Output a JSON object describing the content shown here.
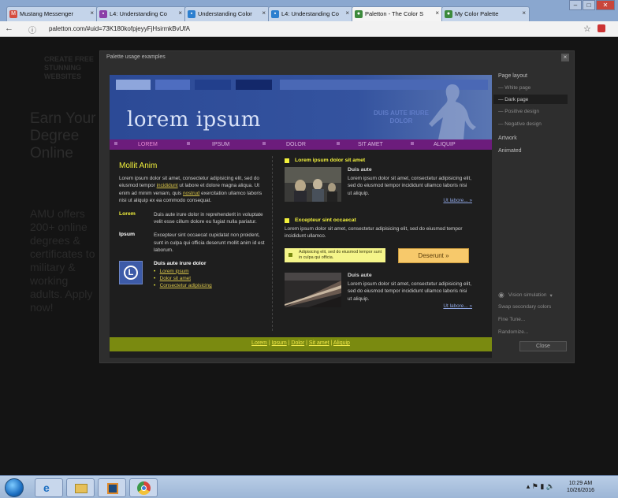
{
  "browser": {
    "tabs": [
      {
        "label": "Mustang Messenger",
        "icon": "gmail-icon",
        "color": "#d54c3f"
      },
      {
        "label": "L4: Understanding Co",
        "icon": "course-icon",
        "color": "#8b3fa8"
      },
      {
        "label": "Understanding Color",
        "icon": "course-icon",
        "color": "#2c7fcf"
      },
      {
        "label": "L4: Understanding Co",
        "icon": "course-icon",
        "color": "#2c7fcf"
      },
      {
        "label": "Paletton - The Color S",
        "icon": "paletton-icon",
        "color": "#3c8a3c"
      },
      {
        "label": "My Color Palette",
        "icon": "paletton-icon",
        "color": "#3c8a3c"
      }
    ],
    "url": "paletton.com/#uid=73K180kofpjeyyFjHsirmkBvUfA"
  },
  "background_ad": {
    "lines": [
      "CREATE FREE",
      "STUNNING",
      "WEBSITES"
    ],
    "headline": "Earn Your Degree Online",
    "body": "AMU offers 200+ online degrees & certificates to military & working adults. Apply now!"
  },
  "modal": {
    "title": "Palette usage examples",
    "close_label": "×"
  },
  "preview": {
    "hero_title": "lorem ipsum",
    "hero_sub": "DUIS AUTE IRURE DOLOR",
    "nav": [
      "LOREM",
      "IPSUM",
      "DOLOR",
      "SIT AMET",
      "ALIQUIP"
    ],
    "left": {
      "heading": "Mollit Anim",
      "para1_a": "Lorem ipsum dolor sit amet, consectetur adipisicing elit, sed do eiusmod tempor ",
      "para1_link1": "incididunt",
      "para1_b": " ut labore et dolore magna aliqua. Ut enim ad minim veniam, quis ",
      "para1_link2": "nostrud",
      "para1_c": " exercitation ullamco laboris nisi ut aliquip ex ea commodo consequat.",
      "def1_term": "Lorem",
      "def1_text": "Duis aute irure dolor in reprehenderit in voluptate velit esse cillum dolore eu fugiat nulla pariatur.",
      "def2_term": "Ipsum",
      "def2_text": "Excepteur sint occaecat cupidatat non proident, sunt in culpa qui officia deserunt mollit anim id est laborum.",
      "list_heading": "Duis aute irure dolor",
      "list": [
        "Lorem ipsum",
        "Dolor sit amet",
        "Consectetur adipisicing"
      ]
    },
    "right": {
      "heading1": "Lorem ipsum dolor sit amet",
      "card1_title": "Duis aute",
      "card1_text": "Lorem ipsum dolor sit amet, consectetur adipisicing elit, sed do eiusmod tempor incididunt ullamco laboris nisi ut aliquip.",
      "card1_link": "Ut labore... »",
      "heading2": "Excepteur sint occaecat",
      "para2": "Lorem ipsum dolor sit amet, consectetur adipisicing elit, sed do eiusmod tempor incididunt ullamco.",
      "note": "Adipisicing elit, sed do eiusmod tempor sunt in culpa qui officia.",
      "button": "Deserunt »",
      "card2_title": "Duis aute",
      "card2_text": "Lorem ipsum dolor sit amet, consectetur adipisicing elit, sed do eiusmod tempor incididunt ullamco laboris nisi ut aliquip.",
      "card2_link": "Ut labore... »"
    },
    "footer_links": [
      "Lorem",
      "Ipsum",
      "Dolor",
      "Sit amet",
      "Aliquip"
    ],
    "footer_sep": "|"
  },
  "sidebar": {
    "page_layout": "Page layout",
    "options": [
      "— White page",
      "— Dark page",
      "— Positive design",
      "— Negative design"
    ],
    "artwork": "Artwork",
    "animated": "Animated",
    "vision": "Vision simulation",
    "vision_caret": "▾",
    "swap": "Swap secondary colors",
    "finetune": "Fine Tune...",
    "randomize": "Randomize...",
    "close": "Close"
  },
  "taskbar": {
    "time": "10:29 AM",
    "date": "10/26/2016"
  },
  "colors": {
    "hero": "#34539f",
    "nav": "#6c1c7c",
    "accent_yellow": "#f2f13c",
    "footer": "#7a8a10",
    "button": "#f7c96b"
  }
}
